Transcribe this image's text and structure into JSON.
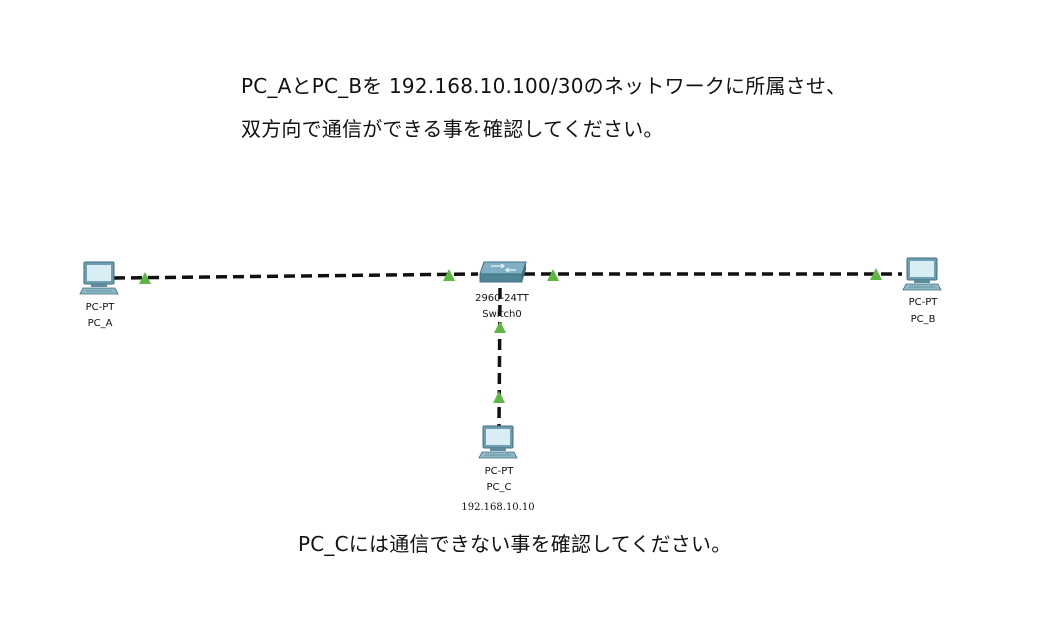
{
  "instructions": {
    "line1": "PC_AとPC_Bを 192.168.10.100/30のネットワークに所属させ、",
    "line2": "双方向で通信ができる事を確認してください。",
    "line3": "PC_Cには通信できない事を確認してください。"
  },
  "devices": {
    "pc_a": {
      "model": "PC-PT",
      "name": "PC_A"
    },
    "pc_b": {
      "model": "PC-PT",
      "name": "PC_B"
    },
    "pc_c": {
      "model": "PC-PT",
      "name": "PC_C",
      "ip": "192.168.10.10"
    },
    "switch0": {
      "model": "2960-24TT",
      "name": "Switch0"
    }
  },
  "colors": {
    "link": "#111111",
    "link_up": "#5cb840",
    "device_body": "#7aa9b8",
    "device_screen": "#d8eef4"
  }
}
